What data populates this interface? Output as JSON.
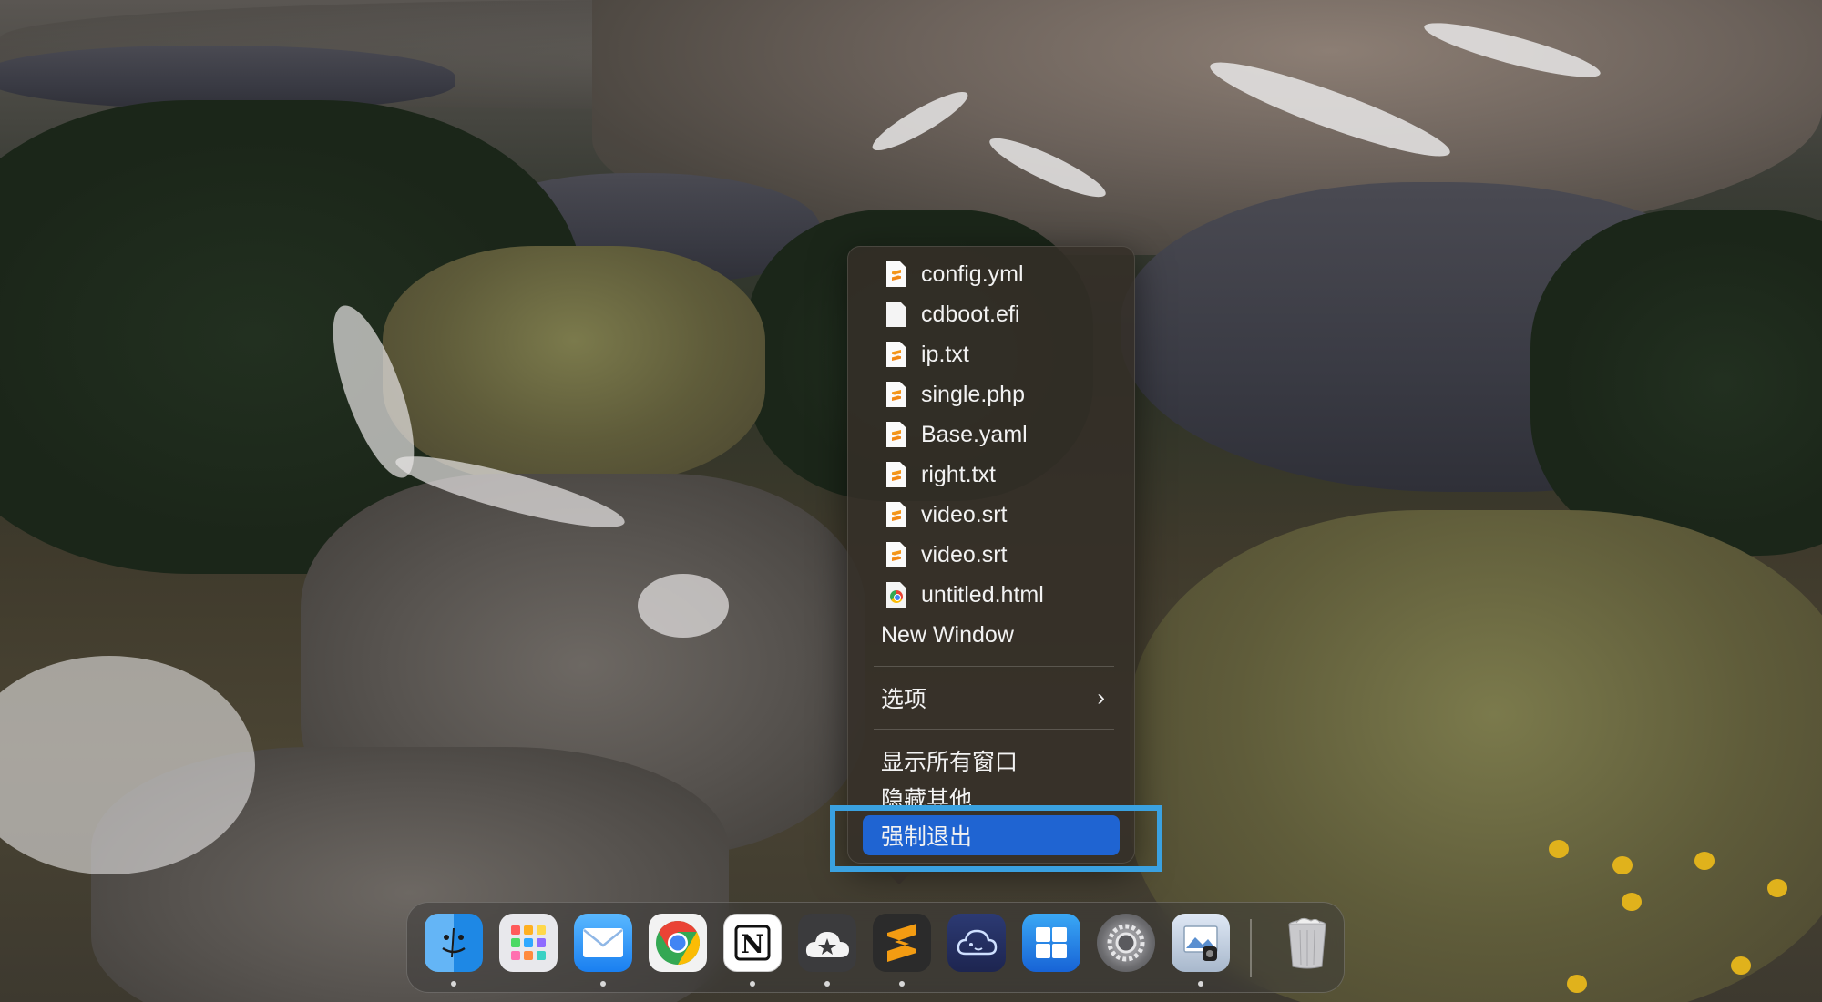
{
  "menu": {
    "recent_files": [
      {
        "label": "config.yml",
        "icon": "sublime-doc-icon"
      },
      {
        "label": "cdboot.efi",
        "icon": "plain-doc-icon"
      },
      {
        "label": "ip.txt",
        "icon": "sublime-doc-icon"
      },
      {
        "label": "single.php",
        "icon": "sublime-doc-icon"
      },
      {
        "label": "Base.yaml",
        "icon": "sublime-doc-icon"
      },
      {
        "label": "right.txt",
        "icon": "sublime-doc-icon"
      },
      {
        "label": "video.srt",
        "icon": "sublime-doc-icon"
      },
      {
        "label": "video.srt",
        "icon": "sublime-doc-icon"
      },
      {
        "label": "untitled.html",
        "icon": "chrome-doc-icon"
      }
    ],
    "new_window": "New Window",
    "options": "选项",
    "options_arrow": "›",
    "show_all_windows": "显示所有窗口",
    "hide_others": "隐藏其他",
    "force_quit": "强制退出"
  },
  "dock": {
    "apps": [
      {
        "name": "Finder",
        "icon": "finder-icon",
        "running": true
      },
      {
        "name": "Launchpad",
        "icon": "launchpad-icon",
        "running": false
      },
      {
        "name": "Mail",
        "icon": "mail-icon",
        "running": true
      },
      {
        "name": "Google Chrome",
        "icon": "chrome-icon",
        "running": false
      },
      {
        "name": "Notion",
        "icon": "notion-icon",
        "running": true
      },
      {
        "name": "Cloud app",
        "icon": "cloud-star-icon",
        "running": true
      },
      {
        "name": "Sublime Text",
        "icon": "sublime-text-icon",
        "running": true
      },
      {
        "name": "Chat app",
        "icon": "cloud-chat-icon",
        "running": false
      },
      {
        "name": "Windows App",
        "icon": "windows-icon",
        "running": false
      },
      {
        "name": "System Settings",
        "icon": "gear-icon",
        "running": false
      },
      {
        "name": "Preview",
        "icon": "preview-icon",
        "running": true
      },
      {
        "name": "Trash",
        "icon": "trash-icon",
        "running": false
      }
    ]
  },
  "colors": {
    "highlight_box": "#3aa1e0",
    "selected_item": "#1f64d2",
    "menu_text": "#f2f2f2"
  }
}
